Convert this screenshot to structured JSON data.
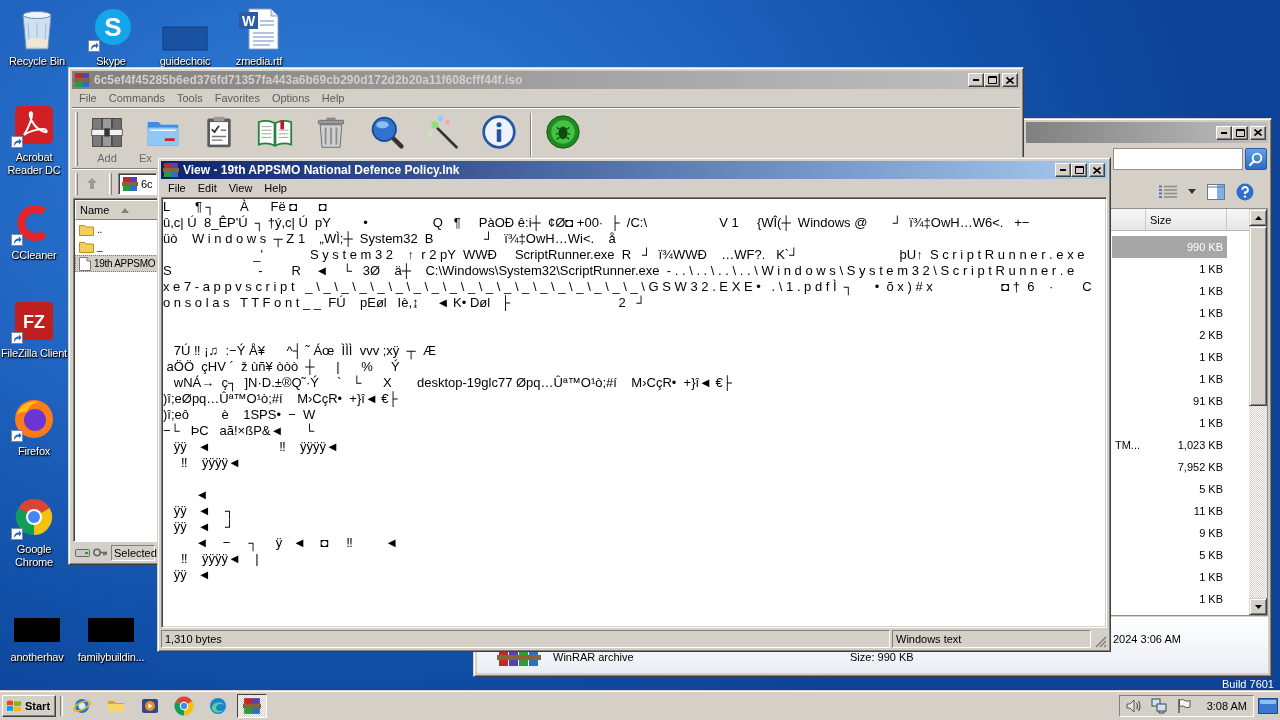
{
  "desktop": {
    "top_row": [
      {
        "label": "Recycle Bin",
        "kind": "recycle",
        "shortcut": false
      },
      {
        "label": "Skype",
        "kind": "skype",
        "shortcut": true,
        "logo_text": "S"
      },
      {
        "label": "guidechoic",
        "kind": "blank",
        "shortcut": false
      },
      {
        "label": "zmedia.rtf",
        "kind": "word",
        "shortcut": false,
        "logo_text": "W"
      }
    ],
    "left_column": [
      {
        "label": "Acrobat Reader DC",
        "kind": "acrobat",
        "shortcut": true
      },
      {
        "label": "CCleaner",
        "kind": "ccleaner",
        "shortcut": true
      },
      {
        "label": "FileZilla Client",
        "kind": "filezilla",
        "shortcut": true,
        "logo_text": "FZ"
      },
      {
        "label": "Firefox",
        "kind": "firefox",
        "shortcut": true
      },
      {
        "label": "Google Chrome",
        "kind": "chrome",
        "shortcut": true
      }
    ],
    "bottom_row": [
      {
        "label": "anotherhav",
        "kind": "image",
        "shortcut": false
      },
      {
        "label": "familybuildin...",
        "kind": "image",
        "shortcut": false
      }
    ],
    "build_label": "Build 7601"
  },
  "archive_window": {
    "active": false,
    "title": "6c5ef4f45285b6ed376fd71357fa443a6b69cb290d172d2b20a11f608cfff44f.iso",
    "menu": [
      "File",
      "Commands",
      "Tools",
      "Favorites",
      "Options",
      "Help"
    ],
    "toolbar": [
      {
        "kind": "add",
        "label": "Add"
      },
      {
        "kind": "extract",
        "label": "Ex"
      },
      {
        "kind": "test"
      },
      {
        "kind": "view"
      },
      {
        "kind": "delete"
      },
      {
        "kind": "find"
      },
      {
        "kind": "wizard"
      },
      {
        "kind": "info"
      },
      {
        "kind": "separator"
      },
      {
        "kind": "virus_scan"
      }
    ],
    "address": "6c",
    "columns": [
      {
        "label": "Name"
      }
    ],
    "files": [
      {
        "name": "..",
        "kind": "folder",
        "selected": false
      },
      {
        "name": "_",
        "kind": "folder",
        "selected": false
      },
      {
        "name": "19th APPSMO",
        "kind": "file",
        "selected": true
      }
    ],
    "status": "Selected"
  },
  "explorer_window": {
    "active": false,
    "columns": [
      {
        "label": "Size"
      }
    ],
    "rows": [
      {
        "size": "990 KB",
        "selected": true
      },
      {
        "size": "1 KB",
        "selected": false
      },
      {
        "size": "1 KB",
        "selected": false
      },
      {
        "size": "1 KB",
        "selected": false
      },
      {
        "size": "2 KB",
        "selected": false
      },
      {
        "size": "1 KB",
        "selected": false
      },
      {
        "size": "1 KB",
        "selected": false
      },
      {
        "size": "91 KB",
        "selected": false
      },
      {
        "size": "1 KB",
        "selected": false
      },
      {
        "name": "TM...",
        "size": "1,023 KB",
        "selected": false
      },
      {
        "size": "7,952 KB",
        "selected": false
      },
      {
        "size": "5 KB",
        "selected": false
      },
      {
        "size": "11 KB",
        "selected": false
      },
      {
        "size": "9 KB",
        "selected": false
      },
      {
        "size": "5 KB",
        "selected": false
      },
      {
        "size": "1 KB",
        "selected": false
      },
      {
        "size": "1 KB",
        "selected": false
      }
    ],
    "details": {
      "date": "2024 3:06 AM",
      "type": "WinRAR archive",
      "size": "Size: 990 KB"
    }
  },
  "viewer_window": {
    "active": true,
    "title": "View - 19th APPSMO National Defence Policy.lnk",
    "menu": [
      "File",
      "Edit",
      "View",
      "Help"
    ],
    "content": "L       ¶ ┐       À      Fë ◘      ◘\nû,c| Ú  8_ÊP'Ú  ┐ †ý,c| Ú  pY         •                  Q   ¶     PàOÐ ê:i┼  ¢Ø◘ +00·  ├  /C:\\                    V 1     {WÎ(┼  Windows @       ┘  ï¾‡OwH…W6<.   +−\nüò    W i n d o w s  ┬ Z 1    „WÌ;┼  System32  B              ┘   ï¾‡OwH…Wi<.    å\n                         _'             S y s t e m 3 2    ↑  r 2 pY  WWÐ     ScriptRunner.exe  R   ┘  ï¾WWÐ    …WF?.   K`┘                            þU↑  S c r i p t R u n n e r . e x e\nS                        -        R    ◄    └   3Ø    ä┼    C:\\Windows\\System32\\ScriptRunner.exe  - . . \\ . . \\ . . \\ . . \\ W i n d o w s \\ S y s t e m 3 2 \\ S c r i p t R u n n e r . e\nx e 7 - a p p v s c r i p t   _ \\ _ \\ _ \\ _ \\ _ \\ _ \\ _ \\ _ \\ _ \\ _ \\ _ \\ _ \\ _ \\ _ \\ _ \\ _ \\ _ \\ _ \\ _ \\ G S W 3 2 . E X E •   . \\ 1 . p d f Ì  ┐      •  õ x ) # x                   ◘ †  6    ·        C\no n s o l a s   T T F o n t _ _  FÚ    pEøl   Iè,↨     ◄ K• Døl   ├                              2   ┘\n\n\n   7Ú ‼ ¡♫  :−Ý Å¥      ^┤ ˜ Áœ  ÌÌÌ  vvv ;xÿ  ┬  Æ\n aÖÖ  çHV ´  ž ùñ¥ òòò  ┼      |      %     Ý\n   wNÁ→  ç┐  ]N·D.±®Q˜·Ý     `   └      X       desktop-19glc77 Øpq…Ûª™O¹ò;#í    M›CçR•  +}î◄ €├\n)î;eØpq…Ûª™O¹ò;#í    M›CçR•  +}î◄ €├\n)î;eô         è    1SPS•  −  W\n−└   ÞC   aã!×ßP&◄      └\n   ÿÿ   ◄                   ‼    ÿÿÿÿ◄\n     ‼    ÿÿÿÿ◄\n\n         ◄\n   ÿÿ   ◄    ┐\n   ÿÿ   ◄    ┘\n         ◄    −     ┐     ÿ   ◄    ◘     ‼         ◄\n     ‼    ÿÿÿÿ◄    |\n   ÿÿ   ◄",
    "status": [
      "1,310 bytes",
      "Windows text"
    ]
  },
  "taskbar": {
    "start": "Start",
    "apps": [
      {
        "kind": "ie",
        "active": false
      },
      {
        "kind": "explorer",
        "active": false
      },
      {
        "kind": "media_player",
        "active": false
      },
      {
        "kind": "chrome",
        "active": false
      },
      {
        "kind": "edge",
        "active": false
      },
      {
        "kind": "winrar",
        "active": true
      }
    ],
    "clock": "3:08 AM"
  }
}
